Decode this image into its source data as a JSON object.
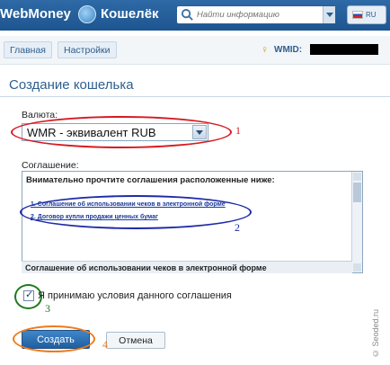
{
  "header": {
    "logo_text": "WebMoney",
    "product_title": "Кошелёк",
    "search_placeholder": "Найти информацию",
    "language": "RU"
  },
  "nav": {
    "tabs": [
      "Главная",
      "Настройки"
    ],
    "wmid_label": "WMID:"
  },
  "page": {
    "title": "Создание кошелька"
  },
  "form": {
    "currency_label": "Валюта:",
    "currency_selected": "WMR - эквивалент RUB",
    "agreement_label": "Соглашение:",
    "agreement_heading": "Внимательно прочтите соглашения расположенные ниже:",
    "agreement_links": [
      "1. Соглашение об использовании чеков в электронной форме",
      "2. Договор купли продажи ценных бумаг"
    ],
    "agreement_footer": "Соглашение об использовании чеков в электронной форме",
    "accept_label": "Я принимаю условия данного соглашения",
    "accept_checked": true,
    "create_button": "Создать",
    "cancel_button": "Отмена"
  },
  "annotations": [
    "1",
    "2",
    "3",
    "4"
  ],
  "watermark": "© Seoded.ru",
  "colors": {
    "header_blue": "#1d5590",
    "link_blue": "#2e5f8f",
    "mark1": "#d71920",
    "mark2": "#1f2aa8",
    "mark3": "#1f7a1f",
    "mark4": "#ef7a1a"
  }
}
